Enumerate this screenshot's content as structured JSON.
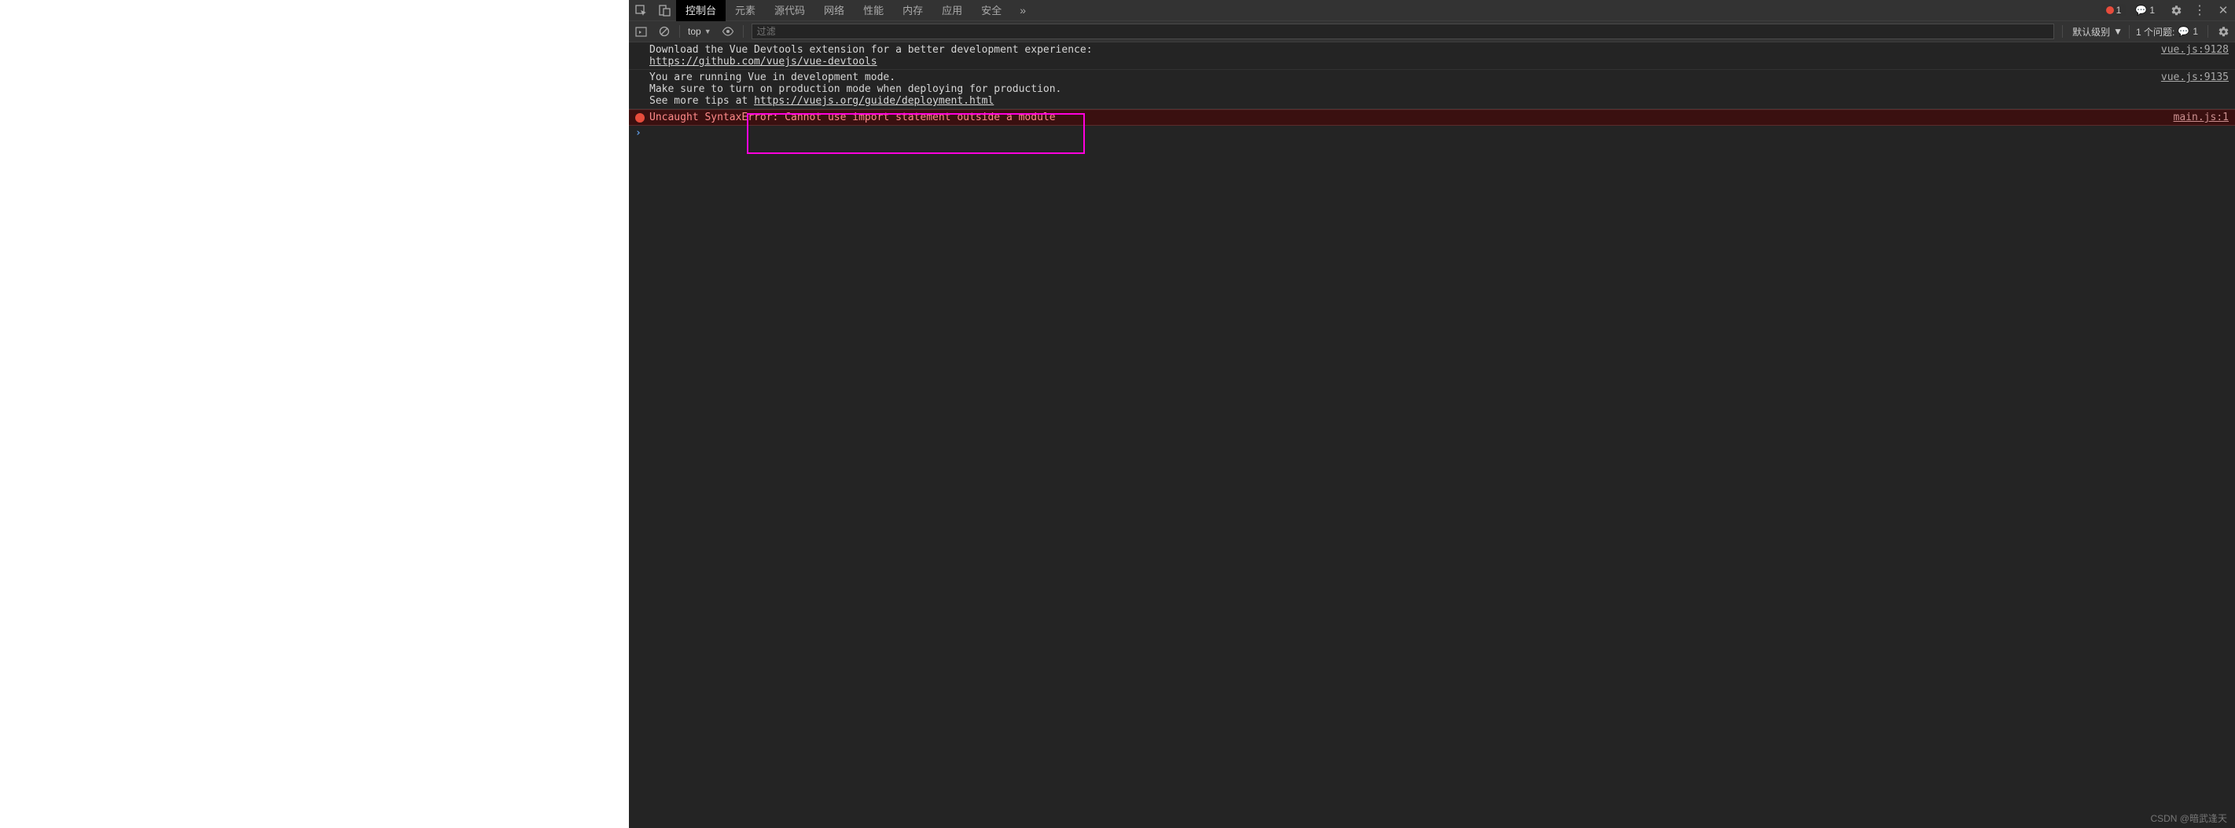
{
  "tabs": {
    "console": "控制台",
    "elements": "元素",
    "sources": "源代码",
    "network": "网络",
    "performance": "性能",
    "memory": "内存",
    "application": "应用",
    "security": "安全"
  },
  "error_badge_count": "1",
  "message_badge_count": "1",
  "filterbar": {
    "context": "top",
    "filter_placeholder": "过滤",
    "level_label": "默认级别",
    "issues_label": "1 个问题:",
    "issues_count": "1"
  },
  "log": {
    "r0_msg": "Download the Vue Devtools extension for a better development experience:",
    "r0_link": "https://github.com/vuejs/vue-devtools",
    "r0_src": "vue.js:9128",
    "r1_l1": "You are running Vue in development mode.",
    "r1_l2": "Make sure to turn on production mode when deploying for production.",
    "r1_l3_prefix": "See more tips at ",
    "r1_l3_link": "https://vuejs.org/guide/deployment.html",
    "r1_src": "vue.js:9135",
    "r2_msg": "Uncaught SyntaxError: Cannot use import statement outside a module",
    "r2_src": "main.js:1"
  },
  "watermark": "CSDN @暗武逢天"
}
